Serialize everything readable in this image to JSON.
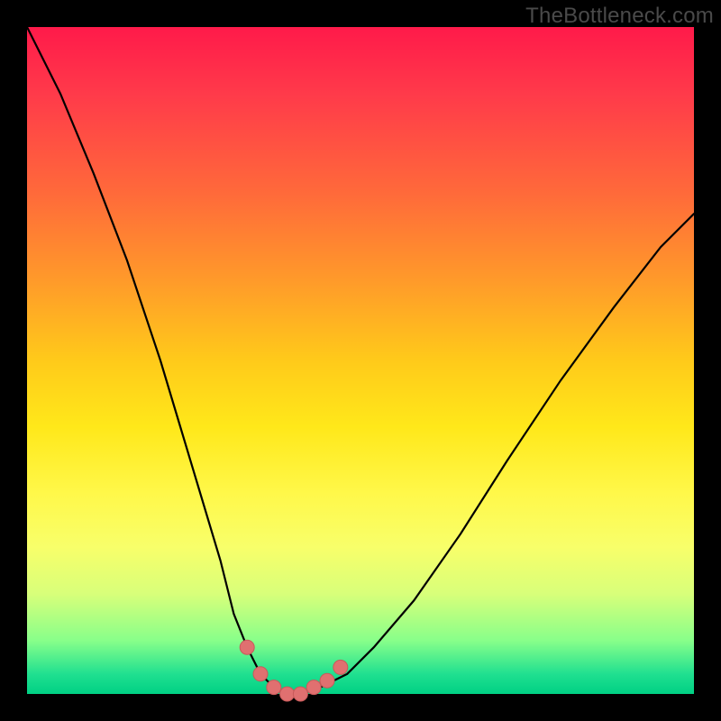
{
  "watermark": "TheBottleneck.com",
  "colors": {
    "curve_stroke": "#000000",
    "marker_fill": "#e07070",
    "marker_stroke": "#c85a5a"
  },
  "chart_data": {
    "type": "line",
    "title": "",
    "xlabel": "",
    "ylabel": "",
    "xlim": [
      0,
      100
    ],
    "ylim": [
      0,
      100
    ],
    "series": [
      {
        "name": "bottleneck-curve",
        "x": [
          0,
          5,
          10,
          15,
          20,
          23,
          26,
          29,
          31,
          33,
          35,
          37,
          39,
          41,
          44,
          48,
          52,
          58,
          65,
          72,
          80,
          88,
          95,
          100
        ],
        "y": [
          100,
          90,
          78,
          65,
          50,
          40,
          30,
          20,
          12,
          7,
          3,
          1,
          0,
          0,
          1,
          3,
          7,
          14,
          24,
          35,
          47,
          58,
          67,
          72
        ]
      }
    ],
    "markers": {
      "name": "highlight-dots",
      "x": [
        33,
        35,
        37,
        39,
        41,
        43,
        45,
        47
      ],
      "y": [
        7,
        3,
        1,
        0,
        0,
        1,
        2,
        4
      ]
    }
  }
}
